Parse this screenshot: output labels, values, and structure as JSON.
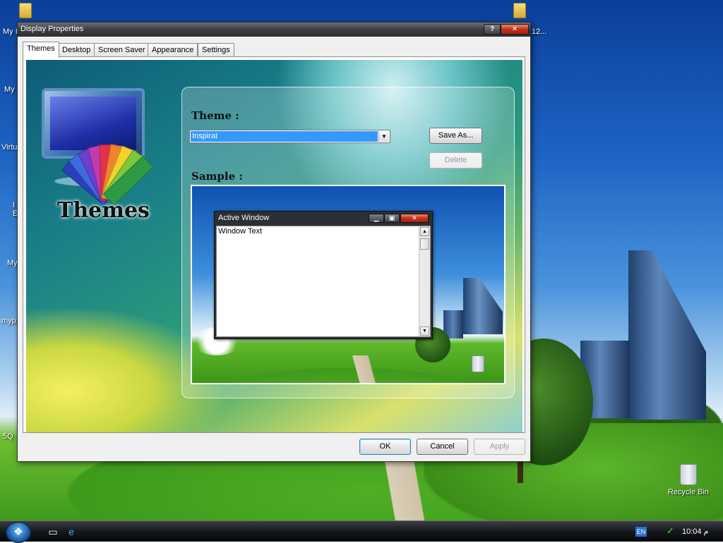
{
  "window": {
    "title": "Display Properties",
    "help_label": "?",
    "close_label": "✕"
  },
  "tabs": [
    {
      "label": "Themes",
      "active": true
    },
    {
      "label": "Desktop",
      "active": false
    },
    {
      "label": "Screen Saver",
      "active": false
    },
    {
      "label": "Appearance",
      "active": false
    },
    {
      "label": "Settings",
      "active": false
    }
  ],
  "themes_panel": {
    "banner_text": "Themes",
    "theme_label": "Theme :",
    "theme_selected": "Inspirat",
    "save_as_label": "Save As...",
    "delete_label": "Delete",
    "sample_label": "Sample :"
  },
  "sample_window": {
    "title": "Active Window",
    "body_text": "Window Text",
    "minimize_label": "▁",
    "maximize_label": "▣",
    "close_label": "✕",
    "scroll_up": "▲",
    "scroll_down": "▼"
  },
  "footer": {
    "ok_label": "OK",
    "cancel_label": "Cancel",
    "apply_label": "Apply"
  },
  "desktop": {
    "icons": [
      {
        "label": "My I",
        "icon": "folder-icon"
      },
      {
        "label": "My",
        "icon": "computer-icon"
      },
      {
        "label": "Virtu",
        "icon": "vm-icon"
      },
      {
        "label": "I",
        "icon": "ie-icon"
      },
      {
        "label": "E",
        "icon": "ie-icon"
      },
      {
        "label": "My",
        "icon": "network-icon"
      },
      {
        "label": "myp",
        "icon": "folder-icon"
      },
      {
        "label": "5Q",
        "icon": "file-icon"
      },
      {
        "label": "12...",
        "icon": "folder-icon"
      }
    ],
    "recycle_bin_label": "Recycle Bin"
  },
  "taskbar": {
    "start_glyph": "❖",
    "language": "EN",
    "clock": "10:04 م"
  },
  "colors": {
    "selection": "#3399ff",
    "titlebar_dark": "#2c3035",
    "close_red": "#c2321a"
  }
}
